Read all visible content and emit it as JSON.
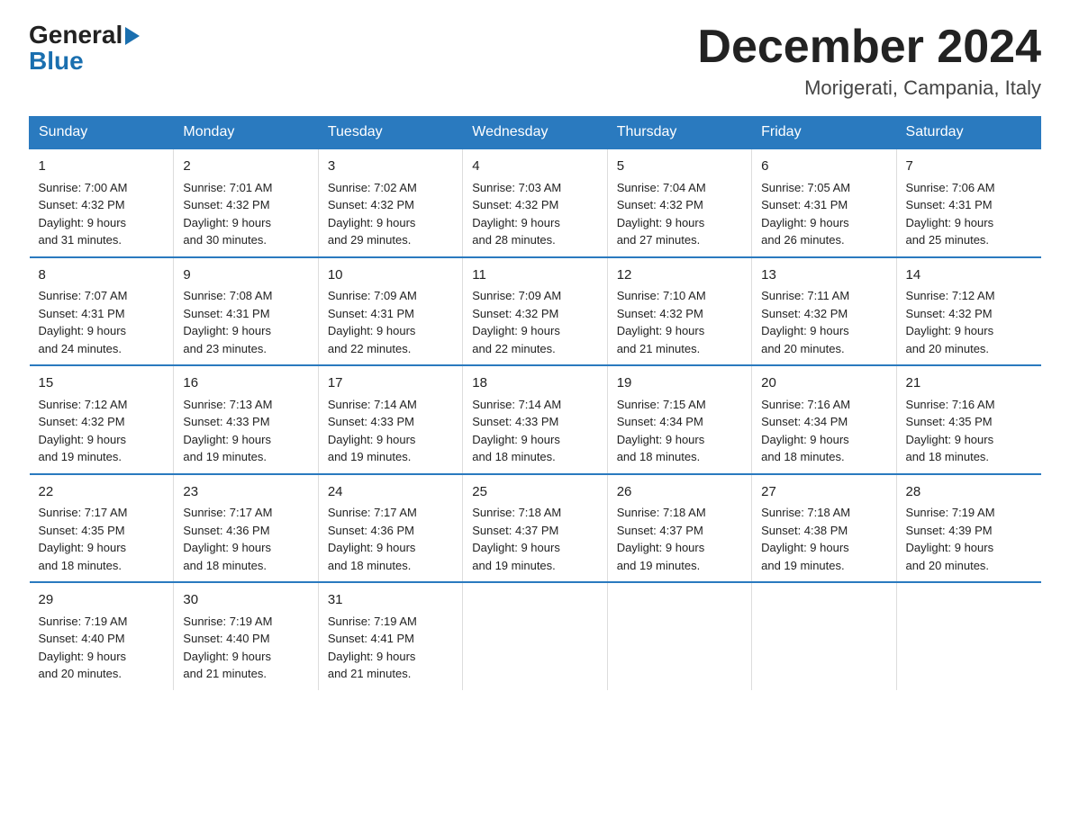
{
  "header": {
    "logo": {
      "general": "General",
      "blue": "Blue"
    },
    "title": "December 2024",
    "location": "Morigerati, Campania, Italy"
  },
  "days_of_week": [
    "Sunday",
    "Monday",
    "Tuesday",
    "Wednesday",
    "Thursday",
    "Friday",
    "Saturday"
  ],
  "weeks": [
    [
      {
        "day": "1",
        "sunrise": "7:00 AM",
        "sunset": "4:32 PM",
        "daylight": "9 hours and 31 minutes."
      },
      {
        "day": "2",
        "sunrise": "7:01 AM",
        "sunset": "4:32 PM",
        "daylight": "9 hours and 30 minutes."
      },
      {
        "day": "3",
        "sunrise": "7:02 AM",
        "sunset": "4:32 PM",
        "daylight": "9 hours and 29 minutes."
      },
      {
        "day": "4",
        "sunrise": "7:03 AM",
        "sunset": "4:32 PM",
        "daylight": "9 hours and 28 minutes."
      },
      {
        "day": "5",
        "sunrise": "7:04 AM",
        "sunset": "4:32 PM",
        "daylight": "9 hours and 27 minutes."
      },
      {
        "day": "6",
        "sunrise": "7:05 AM",
        "sunset": "4:31 PM",
        "daylight": "9 hours and 26 minutes."
      },
      {
        "day": "7",
        "sunrise": "7:06 AM",
        "sunset": "4:31 PM",
        "daylight": "9 hours and 25 minutes."
      }
    ],
    [
      {
        "day": "8",
        "sunrise": "7:07 AM",
        "sunset": "4:31 PM",
        "daylight": "9 hours and 24 minutes."
      },
      {
        "day": "9",
        "sunrise": "7:08 AM",
        "sunset": "4:31 PM",
        "daylight": "9 hours and 23 minutes."
      },
      {
        "day": "10",
        "sunrise": "7:09 AM",
        "sunset": "4:31 PM",
        "daylight": "9 hours and 22 minutes."
      },
      {
        "day": "11",
        "sunrise": "7:09 AM",
        "sunset": "4:32 PM",
        "daylight": "9 hours and 22 minutes."
      },
      {
        "day": "12",
        "sunrise": "7:10 AM",
        "sunset": "4:32 PM",
        "daylight": "9 hours and 21 minutes."
      },
      {
        "day": "13",
        "sunrise": "7:11 AM",
        "sunset": "4:32 PM",
        "daylight": "9 hours and 20 minutes."
      },
      {
        "day": "14",
        "sunrise": "7:12 AM",
        "sunset": "4:32 PM",
        "daylight": "9 hours and 20 minutes."
      }
    ],
    [
      {
        "day": "15",
        "sunrise": "7:12 AM",
        "sunset": "4:32 PM",
        "daylight": "9 hours and 19 minutes."
      },
      {
        "day": "16",
        "sunrise": "7:13 AM",
        "sunset": "4:33 PM",
        "daylight": "9 hours and 19 minutes."
      },
      {
        "day": "17",
        "sunrise": "7:14 AM",
        "sunset": "4:33 PM",
        "daylight": "9 hours and 19 minutes."
      },
      {
        "day": "18",
        "sunrise": "7:14 AM",
        "sunset": "4:33 PM",
        "daylight": "9 hours and 18 minutes."
      },
      {
        "day": "19",
        "sunrise": "7:15 AM",
        "sunset": "4:34 PM",
        "daylight": "9 hours and 18 minutes."
      },
      {
        "day": "20",
        "sunrise": "7:16 AM",
        "sunset": "4:34 PM",
        "daylight": "9 hours and 18 minutes."
      },
      {
        "day": "21",
        "sunrise": "7:16 AM",
        "sunset": "4:35 PM",
        "daylight": "9 hours and 18 minutes."
      }
    ],
    [
      {
        "day": "22",
        "sunrise": "7:17 AM",
        "sunset": "4:35 PM",
        "daylight": "9 hours and 18 minutes."
      },
      {
        "day": "23",
        "sunrise": "7:17 AM",
        "sunset": "4:36 PM",
        "daylight": "9 hours and 18 minutes."
      },
      {
        "day": "24",
        "sunrise": "7:17 AM",
        "sunset": "4:36 PM",
        "daylight": "9 hours and 18 minutes."
      },
      {
        "day": "25",
        "sunrise": "7:18 AM",
        "sunset": "4:37 PM",
        "daylight": "9 hours and 19 minutes."
      },
      {
        "day": "26",
        "sunrise": "7:18 AM",
        "sunset": "4:37 PM",
        "daylight": "9 hours and 19 minutes."
      },
      {
        "day": "27",
        "sunrise": "7:18 AM",
        "sunset": "4:38 PM",
        "daylight": "9 hours and 19 minutes."
      },
      {
        "day": "28",
        "sunrise": "7:19 AM",
        "sunset": "4:39 PM",
        "daylight": "9 hours and 20 minutes."
      }
    ],
    [
      {
        "day": "29",
        "sunrise": "7:19 AM",
        "sunset": "4:40 PM",
        "daylight": "9 hours and 20 minutes."
      },
      {
        "day": "30",
        "sunrise": "7:19 AM",
        "sunset": "4:40 PM",
        "daylight": "9 hours and 21 minutes."
      },
      {
        "day": "31",
        "sunrise": "7:19 AM",
        "sunset": "4:41 PM",
        "daylight": "9 hours and 21 minutes."
      },
      null,
      null,
      null,
      null
    ]
  ],
  "labels": {
    "sunrise": "Sunrise:",
    "sunset": "Sunset:",
    "daylight": "Daylight:"
  }
}
